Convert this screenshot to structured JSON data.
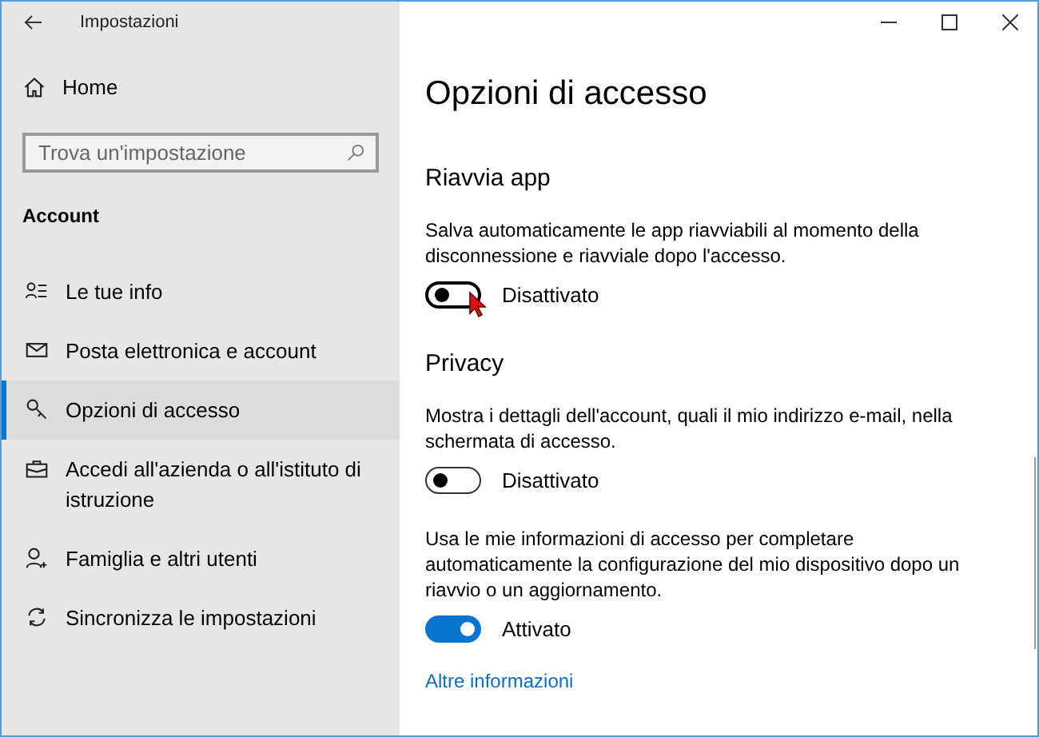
{
  "window": {
    "title": "Impostazioni"
  },
  "sidebar": {
    "home": "Home",
    "search": {
      "placeholder": "Trova un'impostazione"
    },
    "section": "Account",
    "items": [
      {
        "label": "Le tue info",
        "selected": false
      },
      {
        "label": "Posta elettronica e account",
        "selected": false
      },
      {
        "label": "Opzioni di accesso",
        "selected": true
      },
      {
        "label": "Accedi all'azienda o all'istituto di istruzione",
        "selected": false
      },
      {
        "label": "Famiglia e altri utenti",
        "selected": false
      },
      {
        "label": "Sincronizza le impostazioni",
        "selected": false
      }
    ]
  },
  "page": {
    "title": "Opzioni di accesso",
    "sections": [
      {
        "heading": "Riavvia app",
        "settings": [
          {
            "description": "Salva automaticamente le app riavviabili al momento della disconnessione e riavviale dopo l'accesso.",
            "on": false,
            "hovered": true,
            "state_label": "Disattivato"
          }
        ]
      },
      {
        "heading": "Privacy",
        "settings": [
          {
            "description": "Mostra i dettagli dell'account, quali il mio indirizzo e-mail, nella schermata di accesso.",
            "on": false,
            "hovered": false,
            "state_label": "Disattivato"
          },
          {
            "description": "Usa le mie informazioni di accesso per completare automaticamente la configurazione del mio dispositivo dopo un riavvio o un aggiornamento.",
            "on": true,
            "hovered": false,
            "state_label": "Attivato"
          }
        ]
      }
    ],
    "link": "Altre informazioni"
  }
}
